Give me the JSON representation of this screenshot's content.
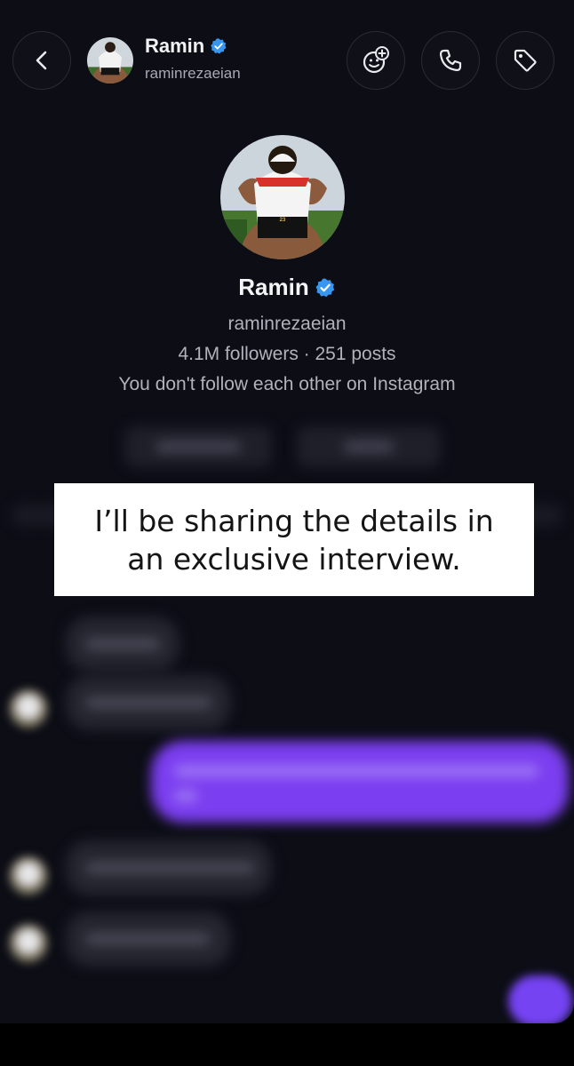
{
  "header": {
    "back_icon": "chevron-left-icon",
    "display_name": "Ramin",
    "username": "raminrezaeian",
    "verified_icon": "verified-badge-icon",
    "actions": [
      "ai-sticker-icon",
      "phone-call-icon",
      "tag-icon"
    ]
  },
  "profile": {
    "display_name": "Ramin",
    "username": "raminrezaeian",
    "stats": "4.1M followers · 251 posts",
    "relationship": "You don't follow each other on Instagram",
    "jersey_number": "23"
  },
  "caption": {
    "text": "I’ll be sharing the details in an exclusive interview."
  },
  "colors": {
    "background": "#0c0d15",
    "verified": "#3797f0",
    "outgoing_bubble": "#7b3ef0",
    "caption_box": "#ffffff"
  }
}
